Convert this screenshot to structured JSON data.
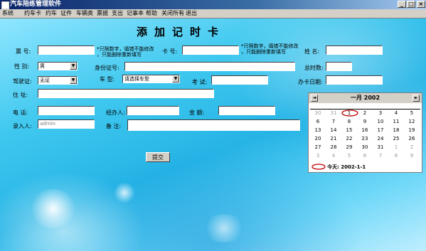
{
  "window": {
    "title": "汽车陪练管理软件",
    "min": "_",
    "max": "□",
    "close": "×"
  },
  "menu": [
    "系统",
    "约车卡",
    "约车",
    "证件",
    "车辆类",
    "票据",
    "支出",
    "记事本",
    "帮助",
    "关闭所有",
    "退出"
  ],
  "form": {
    "title": "添加记时卡",
    "ticket_label": "票  号:",
    "ticket_value": "",
    "ticket_note1": "*只限数字，填错不能修改",
    "ticket_note2": "，只能删除重新填写",
    "card_label": "卡  号:",
    "card_value": "",
    "card_note1": "*只限数字，填错不能修改",
    "card_note2": "，只能删除重新填写",
    "name_label": "姓  名:",
    "name_value": "",
    "gender_label": "性  别:",
    "gender_value": "男",
    "idcard_label": "身份证号:",
    "idcard_value": "",
    "total_hours_label": "总时数:",
    "total_hours_value": "",
    "license_label": "驾驶证:",
    "license_value": "无证",
    "car_type_label": "车  型:",
    "car_type_value": "请选择车型",
    "exam_label": "考  试:",
    "exam_value": "",
    "card_date_label": "办卡日期:",
    "card_date_value": "",
    "address_label": "住  址:",
    "address_value": "",
    "phone_label": "电  话:",
    "phone_value": "",
    "handler_label": "经办人:",
    "handler_value": "",
    "amount_label": "金  额:",
    "amount_value": "",
    "entered_by_label": "录入人:",
    "entered_by_value": "admin",
    "remark_label": "备  注:",
    "remark_value": "",
    "submit_label": "提交"
  },
  "calendar": {
    "prev": "◄",
    "next": "►",
    "title": "一月  2002",
    "weekdays": [
      "",
      "",
      "",
      "",
      "",
      "",
      ""
    ],
    "days": [
      [
        "30",
        "31",
        "1",
        "2",
        "3",
        "4",
        "5"
      ],
      [
        "6",
        "7",
        "8",
        "9",
        "10",
        "11",
        "12"
      ],
      [
        "13",
        "14",
        "15",
        "16",
        "17",
        "18",
        "19"
      ],
      [
        "20",
        "21",
        "22",
        "23",
        "24",
        "25",
        "26"
      ],
      [
        "27",
        "28",
        "29",
        "30",
        "31",
        "1",
        "2"
      ],
      [
        "3",
        "4",
        "5",
        "6",
        "7",
        "8",
        "9"
      ]
    ],
    "dim_cells": [
      [
        0,
        0
      ],
      [
        0,
        1
      ],
      [
        4,
        5
      ],
      [
        4,
        6
      ],
      [
        5,
        0
      ],
      [
        5,
        1
      ],
      [
        5,
        2
      ],
      [
        5,
        3
      ],
      [
        5,
        4
      ],
      [
        5,
        5
      ],
      [
        5,
        6
      ]
    ],
    "today_text": "今天:  2002-1-1",
    "highlight_color": "#c00000"
  }
}
